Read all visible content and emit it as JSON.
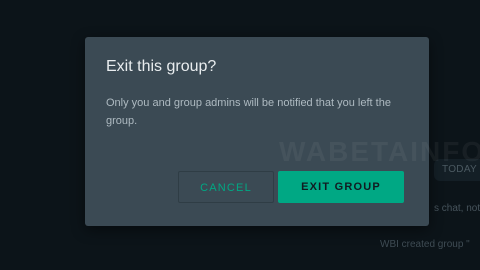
{
  "background": {
    "today_label": "TODAY",
    "chat_line": "s chat, not",
    "created_line": "WBI created group \""
  },
  "dialog": {
    "title": "Exit this group?",
    "message": "Only you and group admins will be notified that you left the group.",
    "watermark": "WABETAINFO",
    "cancel_label": "CANCEL",
    "confirm_label": "EXIT GROUP"
  },
  "colors": {
    "accent": "#00a884",
    "dialog_bg": "#3b4a54",
    "screen_bg": "#0c1419"
  }
}
